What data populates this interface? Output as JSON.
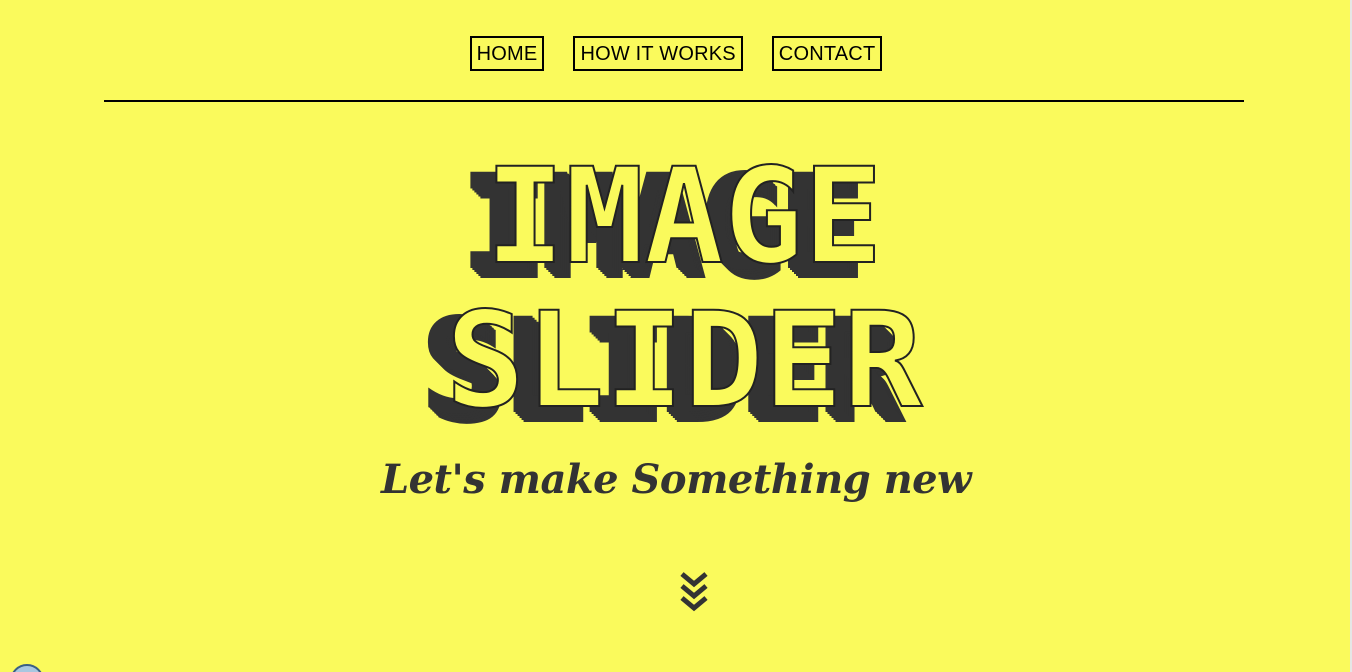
{
  "nav": {
    "items": [
      {
        "label": "HOME"
      },
      {
        "label": "HOW IT WORKS"
      },
      {
        "label": "CONTACT"
      }
    ]
  },
  "hero": {
    "title_line1": "IMAGE",
    "title_line2": "SLIDER",
    "subtitle": "Let's make Something new",
    "scroll_icon": "double-chevron-down-icon"
  },
  "colors": {
    "background": "#fafa5c",
    "text": "#333333",
    "border": "#000000"
  }
}
